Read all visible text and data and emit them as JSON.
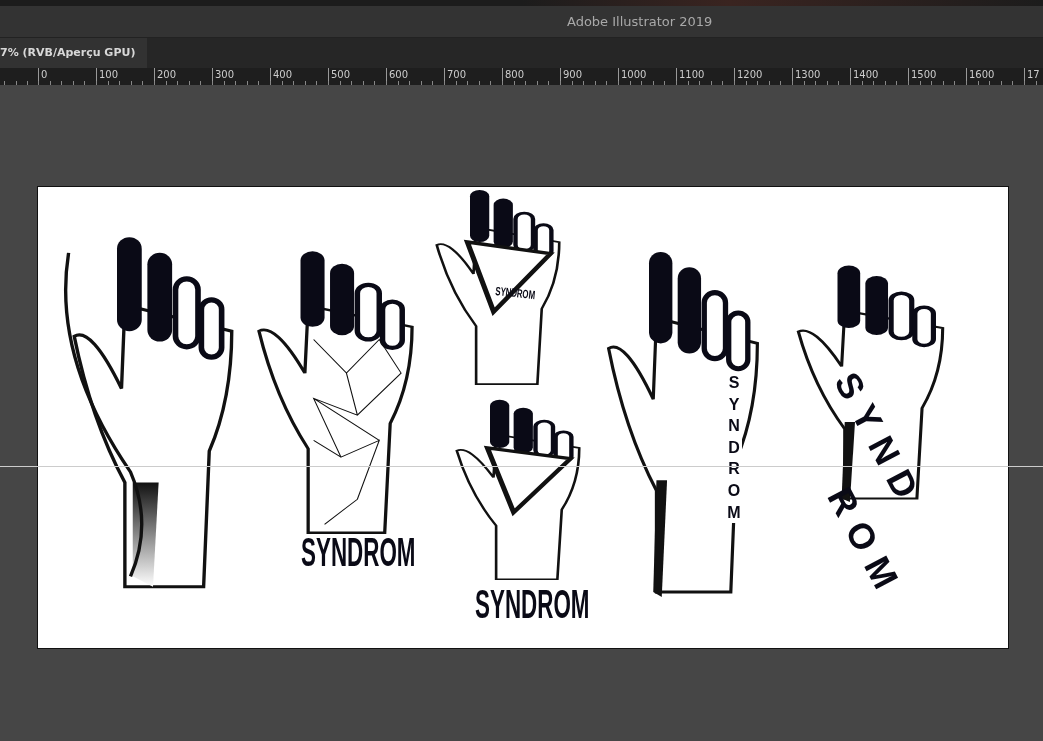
{
  "window": {
    "title": "Adobe Illustrator 2019"
  },
  "document_tab": {
    "label": "7% (RVB/Aperçu GPU)",
    "selected": true
  },
  "ruler": {
    "labels": [
      "0",
      "100",
      "200",
      "300",
      "400",
      "500",
      "600",
      "700",
      "800",
      "900",
      "1000",
      "1100",
      "1200",
      "1300",
      "1400",
      "1500",
      "1600",
      "17"
    ]
  },
  "artboard": {
    "artworks": [
      {
        "kind": "gradient-hand"
      },
      {
        "kind": "polygon-hand",
        "labels": [
          "SYNDROM"
        ]
      },
      {
        "kind": "triangle-hand",
        "labels": [
          "SYNDROM"
        ]
      },
      {
        "kind": "triangle-hand-captioned",
        "labels": [
          "SYNDROM"
        ]
      },
      {
        "kind": "plain-hand-vertical",
        "labels": [
          "SYNDROM"
        ]
      },
      {
        "kind": "plain-hand-rotated",
        "labels": [
          "SYND",
          "ROM"
        ]
      }
    ]
  }
}
